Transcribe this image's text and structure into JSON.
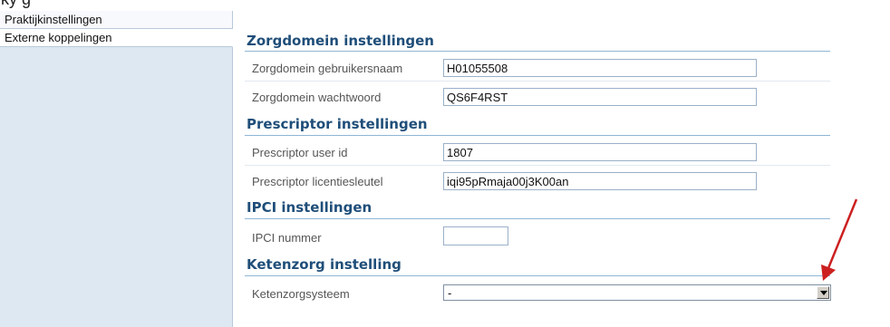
{
  "sidebar": {
    "items": [
      {
        "label": "Praktijkinstellingen"
      },
      {
        "label": "Externe koppelingen"
      }
    ]
  },
  "sections": {
    "zorgdomein": {
      "title": "Zorgdomein instellingen",
      "username_label": "Zorgdomein gebruikersnaam",
      "username_value": "H01055508",
      "password_label": "Zorgdomein wachtwoord",
      "password_value": "QS6F4RST"
    },
    "prescriptor": {
      "title": "Prescriptor instellingen",
      "userid_label": "Prescriptor user id",
      "userid_value": "1807",
      "license_label": "Prescriptor licentiesleutel",
      "license_value": "iqi95pRmaja00j3K00an"
    },
    "ipci": {
      "title": "IPCI instellingen",
      "number_label": "IPCI nummer",
      "number_value": ""
    },
    "ketenzorg": {
      "title": "Ketenzorg instelling",
      "system_label": "Ketenzorgsysteem",
      "system_value": "-"
    }
  },
  "annotation": {
    "arrow_color": "#cc2020"
  }
}
